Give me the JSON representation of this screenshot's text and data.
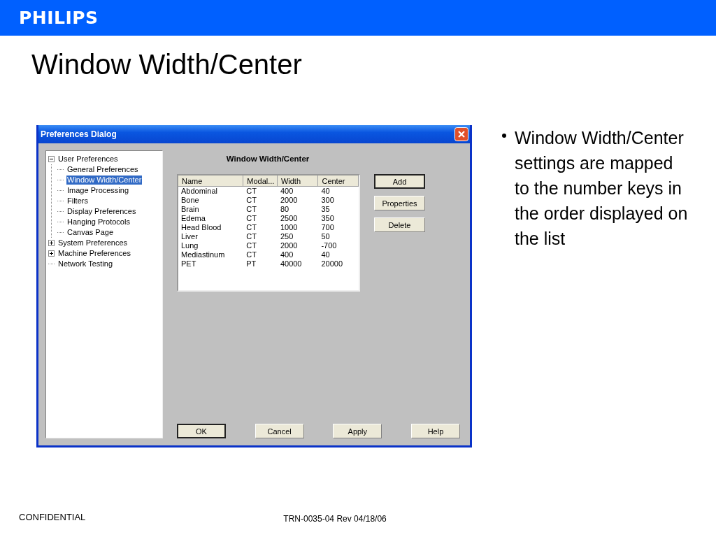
{
  "header": {
    "logo": "PHILIPS"
  },
  "slide_title": "Window Width/Center",
  "dialog": {
    "title": "Preferences Dialog",
    "tree": [
      {
        "label": "User Preferences",
        "expanded": true,
        "selected": false,
        "children": [
          {
            "label": "General Preferences",
            "selected": false
          },
          {
            "label": "Window Width/Center",
            "selected": true
          },
          {
            "label": "Image Processing",
            "selected": false
          },
          {
            "label": "Filters",
            "selected": false
          },
          {
            "label": "Display Preferences",
            "selected": false
          },
          {
            "label": "Hanging Protocols",
            "selected": false
          },
          {
            "label": "Canvas Page",
            "selected": false
          }
        ]
      },
      {
        "label": "System Preferences",
        "expanded": false,
        "selected": false
      },
      {
        "label": "Machine Preferences",
        "expanded": false,
        "selected": false
      },
      {
        "label": "Network Testing",
        "selected": false
      }
    ],
    "section_heading": "Window Width/Center",
    "table": {
      "columns": [
        "Name",
        "Modal...",
        "Width",
        "Center"
      ],
      "rows": [
        [
          "Abdominal",
          "CT",
          "400",
          "40"
        ],
        [
          "Bone",
          "CT",
          "2000",
          "300"
        ],
        [
          "Brain",
          "CT",
          "80",
          "35"
        ],
        [
          "Edema",
          "CT",
          "2500",
          "350"
        ],
        [
          "Head Blood",
          "CT",
          "1000",
          "700"
        ],
        [
          "Liver",
          "CT",
          "250",
          "50"
        ],
        [
          "Lung",
          "CT",
          "2000",
          "-700"
        ],
        [
          "Mediastinum",
          "CT",
          "400",
          "40"
        ],
        [
          "PET",
          "PT",
          "40000",
          "20000"
        ]
      ]
    },
    "side_buttons": [
      {
        "label": "Add",
        "default": true
      },
      {
        "label": "Properties",
        "default": false
      },
      {
        "label": "Delete",
        "default": false
      }
    ],
    "bottom_buttons": [
      {
        "label": "OK",
        "default": true
      },
      {
        "label": "Cancel",
        "default": false
      },
      {
        "label": "Apply",
        "default": false
      },
      {
        "label": "Help",
        "default": false
      }
    ]
  },
  "bullets": [
    "Window Width/Center settings are mapped to the number keys in the order displayed on the list"
  ],
  "footer": {
    "left": "CONFIDENTIAL",
    "center": "TRN-0035-04 Rev 04/18/06"
  }
}
